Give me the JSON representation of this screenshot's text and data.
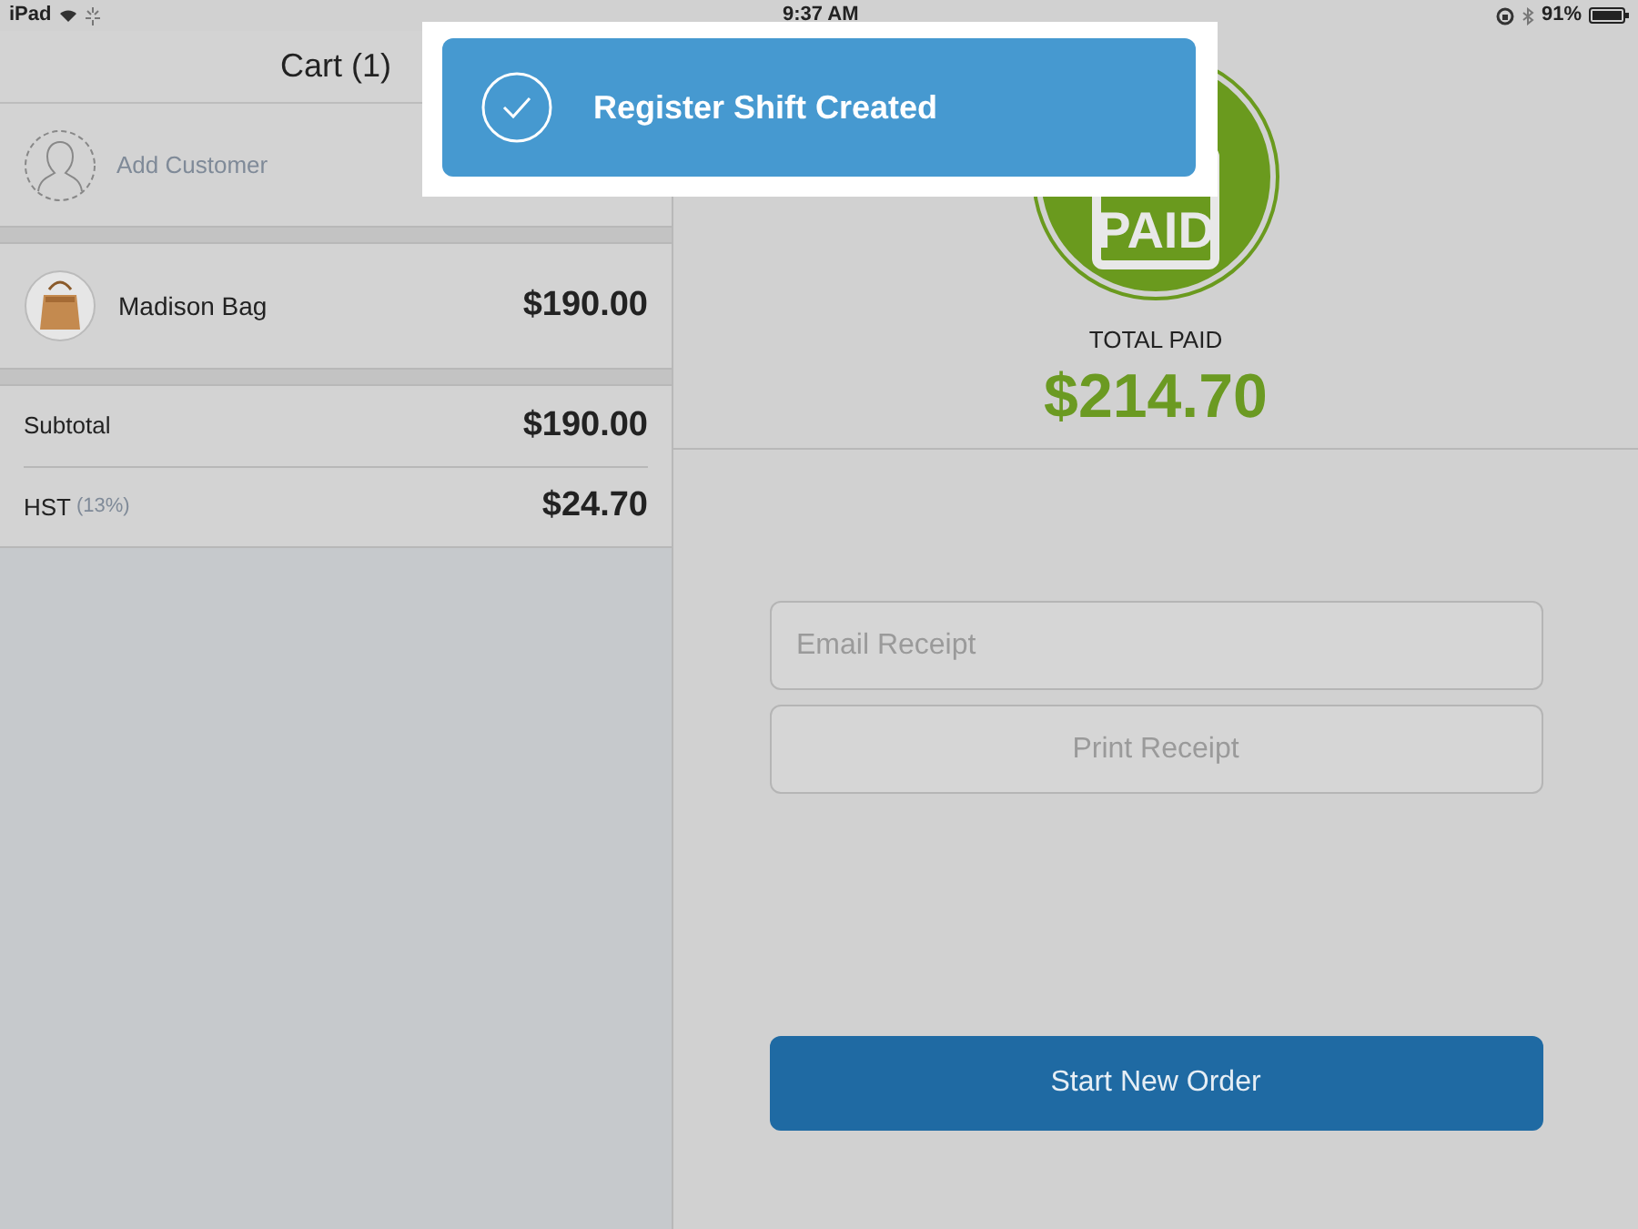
{
  "status_bar": {
    "device": "iPad",
    "time": "9:37 AM",
    "battery": "91%"
  },
  "cart": {
    "title": "Cart (1)",
    "add_customer": "Add Customer",
    "items": [
      {
        "name": "Madison Bag",
        "price": "$190.00"
      }
    ],
    "totals": [
      {
        "label": "Subtotal",
        "value": "$190.00"
      },
      {
        "label": "HST",
        "note": "(13%)",
        "value": "$24.70"
      }
    ]
  },
  "payment": {
    "stamp": "PAID",
    "total_label": "TOTAL PAID",
    "total": "$214.70",
    "email_placeholder": "Email Receipt",
    "print_button": "Print Receipt",
    "start_button": "Start New Order"
  },
  "toast": {
    "message": "Register Shift Created"
  }
}
